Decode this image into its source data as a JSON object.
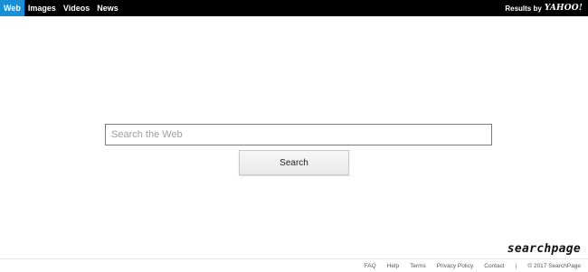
{
  "topbar": {
    "tabs": [
      {
        "label": "Web",
        "active": true
      },
      {
        "label": "Images",
        "active": false
      },
      {
        "label": "Videos",
        "active": false
      },
      {
        "label": "News",
        "active": false
      }
    ],
    "results_by": "Results by",
    "provider_logo": "YAHOO!"
  },
  "search": {
    "placeholder": "Search the Web",
    "value": "",
    "button_label": "Search"
  },
  "brand": {
    "logo_text": "searchpage"
  },
  "footer": {
    "links": [
      "FAQ",
      "Help",
      "Terms",
      "Privacy Policy",
      "Contact"
    ],
    "separator": "|",
    "copyright": "© 2017 SearchPage"
  },
  "colors": {
    "topbar_bg": "#000000",
    "active_tab_bg": "#1a8fd6",
    "page_bg": "#ffffff"
  }
}
